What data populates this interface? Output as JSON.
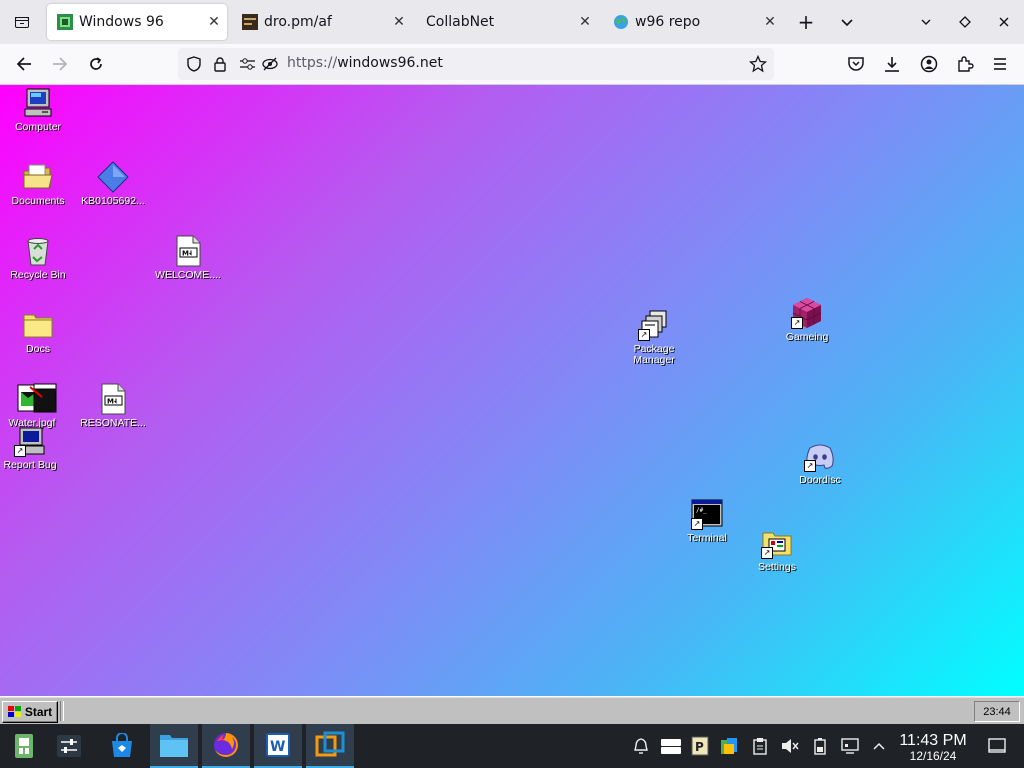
{
  "browser": {
    "tabs": [
      {
        "title": "Windows 96",
        "active": true
      },
      {
        "title": "dro.pm/af",
        "active": false
      },
      {
        "title": "CollabNet",
        "active": false
      },
      {
        "title": "w96 repo",
        "active": false
      }
    ],
    "url_scheme": "https://",
    "url_host": "windows96.net",
    "icons": [
      "tab-list-icon",
      "new-tab-icon",
      "tab-overflow-icon",
      "chevron-down-icon",
      "maximize-icon",
      "close-icon",
      "back-icon",
      "forward-icon",
      "reload-icon",
      "shield-icon",
      "lock-icon",
      "permissions-icon",
      "tracking-icon",
      "bookmark-star-icon",
      "pocket-icon",
      "download-icon",
      "account-icon",
      "extensions-icon",
      "menu-icon"
    ]
  },
  "desktop": {
    "icons": [
      {
        "label": "Computer",
        "icon": "computer-icon"
      },
      {
        "label": "Documents",
        "icon": "folder-open-icon"
      },
      {
        "label": "KB0105692...",
        "icon": "diamond-icon"
      },
      {
        "label": "Recycle Bin",
        "icon": "recycle-bin-icon"
      },
      {
        "label": "WELCOME....",
        "icon": "markdown-file-icon"
      },
      {
        "label": "Docs",
        "icon": "folder-icon"
      },
      {
        "label": "Water.jpgf",
        "icon": "image-file-icon"
      },
      {
        "label": "RESONATE...",
        "icon": "markdown-file-icon"
      },
      {
        "label": "Report Bug",
        "icon": "report-bug-icon"
      },
      {
        "label": "Package\nManager",
        "icon": "package-icon"
      },
      {
        "label": "Gameing",
        "icon": "game-cube-icon"
      },
      {
        "label": "Doordisc",
        "icon": "discord-icon"
      },
      {
        "label": "Terminal",
        "icon": "terminal-icon"
      },
      {
        "label": "Settings",
        "icon": "settings-folder-icon"
      }
    ]
  },
  "w96_taskbar": {
    "start_label": "Start",
    "clock": "23:44"
  },
  "host_panel": {
    "time": "11:43 PM",
    "date": "12/16/24",
    "apps": [
      "app-launcher-icon",
      "settings-sliders-icon",
      "store-icon",
      "file-manager-icon",
      "firefox-icon",
      "wps-writer-icon",
      "virtualbox-icon"
    ],
    "tray": [
      "notifications-icon",
      "window-icon",
      "parsec-icon",
      "clipboard-tray-icon",
      "clipboard-icon",
      "volume-muted-icon",
      "battery-icon",
      "network-icon",
      "tray-expand-icon",
      "show-desktop-icon"
    ]
  }
}
